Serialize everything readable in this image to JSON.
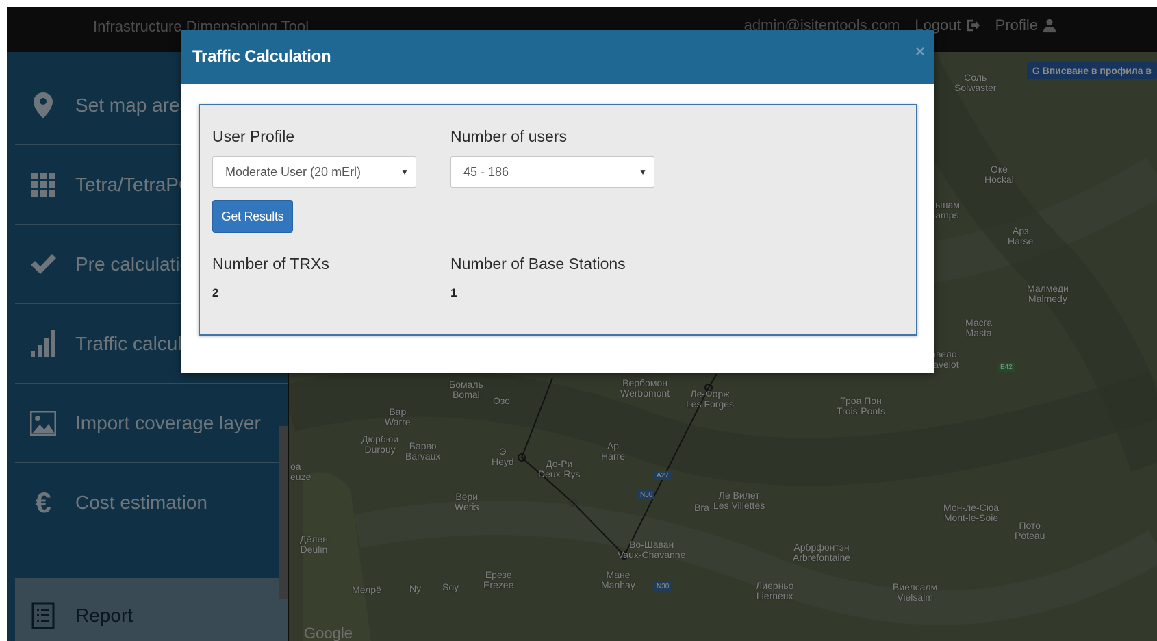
{
  "navbar": {
    "title": "Infrastructure Dimensioning Tool",
    "email": "admin@isitentools.com",
    "logout": "Logout",
    "profile": "Profile"
  },
  "sidebar": {
    "items": [
      {
        "label": "Set map area",
        "icon": "map-marker-icon"
      },
      {
        "label": "Tetra/TetraPOL",
        "icon": "grid-icon"
      },
      {
        "label": "Pre calculation",
        "icon": "checkmark-icon"
      },
      {
        "label": "Traffic calculation",
        "icon": "signal-bars-icon"
      },
      {
        "label": "Import coverage layer",
        "icon": "image-icon"
      },
      {
        "label": "Cost estimation",
        "icon": "euro-icon"
      }
    ],
    "report": "Report"
  },
  "map": {
    "signin_button": "G Вписване в профила в",
    "google": "Google",
    "labels": [
      {
        "text": "Бомаль\nBomal"
      },
      {
        "text": "Озо"
      },
      {
        "text": "Вар\nWarre"
      },
      {
        "text": "Дюрбюи\nDurbuy"
      },
      {
        "text": "Барво\nBarvaux"
      },
      {
        "text": "Э\nHeyd"
      },
      {
        "text": "До-Ри\nDeux-Rys"
      },
      {
        "text": "Ар\nHarre"
      },
      {
        "text": "Вербомон\nWerbomont"
      },
      {
        "text": "Ле-Форж\nLes Forges"
      },
      {
        "text": "Троа Пон\nTrois-Ponts"
      },
      {
        "text": "Вери\nWeris"
      },
      {
        "text": "Ле Вилет\nLes Villettes"
      },
      {
        "text": "Bra"
      },
      {
        "text": "Во-Шаван\nVaux-Chavanne"
      },
      {
        "text": "Дёлен\nDeulin"
      },
      {
        "text": "Ерезе\nErezee"
      },
      {
        "text": "Мане\nManhay"
      },
      {
        "text": "Арбрфонтэн\nArbrefontaine"
      },
      {
        "text": "Лиерньо\nLierneux"
      },
      {
        "text": "Виелсалм\nVielsalm"
      },
      {
        "text": "Мон-ле-Сюа\nMont-le-Soie"
      },
      {
        "text": "Пото\nPoteau"
      },
      {
        "text": "Соль\nSolwaster"
      },
      {
        "text": "Оке\nHockai"
      },
      {
        "text": "альшам\nchamps"
      },
      {
        "text": "Арз\nHarse"
      },
      {
        "text": "Малмеди\nMalmedy"
      },
      {
        "text": "Масга\nMasta"
      },
      {
        "text": "тавело\nStavelot"
      },
      {
        "text": "Мелрё"
      },
      {
        "text": "Ny"
      },
      {
        "text": "Soy"
      },
      {
        "text": "оа\neuze"
      }
    ],
    "road_badges": [
      "A27",
      "N30",
      "N30",
      "E42"
    ]
  },
  "modal": {
    "title": "Traffic Calculation",
    "close": "×",
    "user_profile_label": "User Profile",
    "user_profile_value": "Moderate User (20 mErl)",
    "users_label": "Number of users",
    "users_value": "45 - 186",
    "button": "Get Results",
    "trx_label": "Number of TRXs",
    "trx_value": "2",
    "bs_label": "Number of Base Stations",
    "bs_value": "1"
  }
}
